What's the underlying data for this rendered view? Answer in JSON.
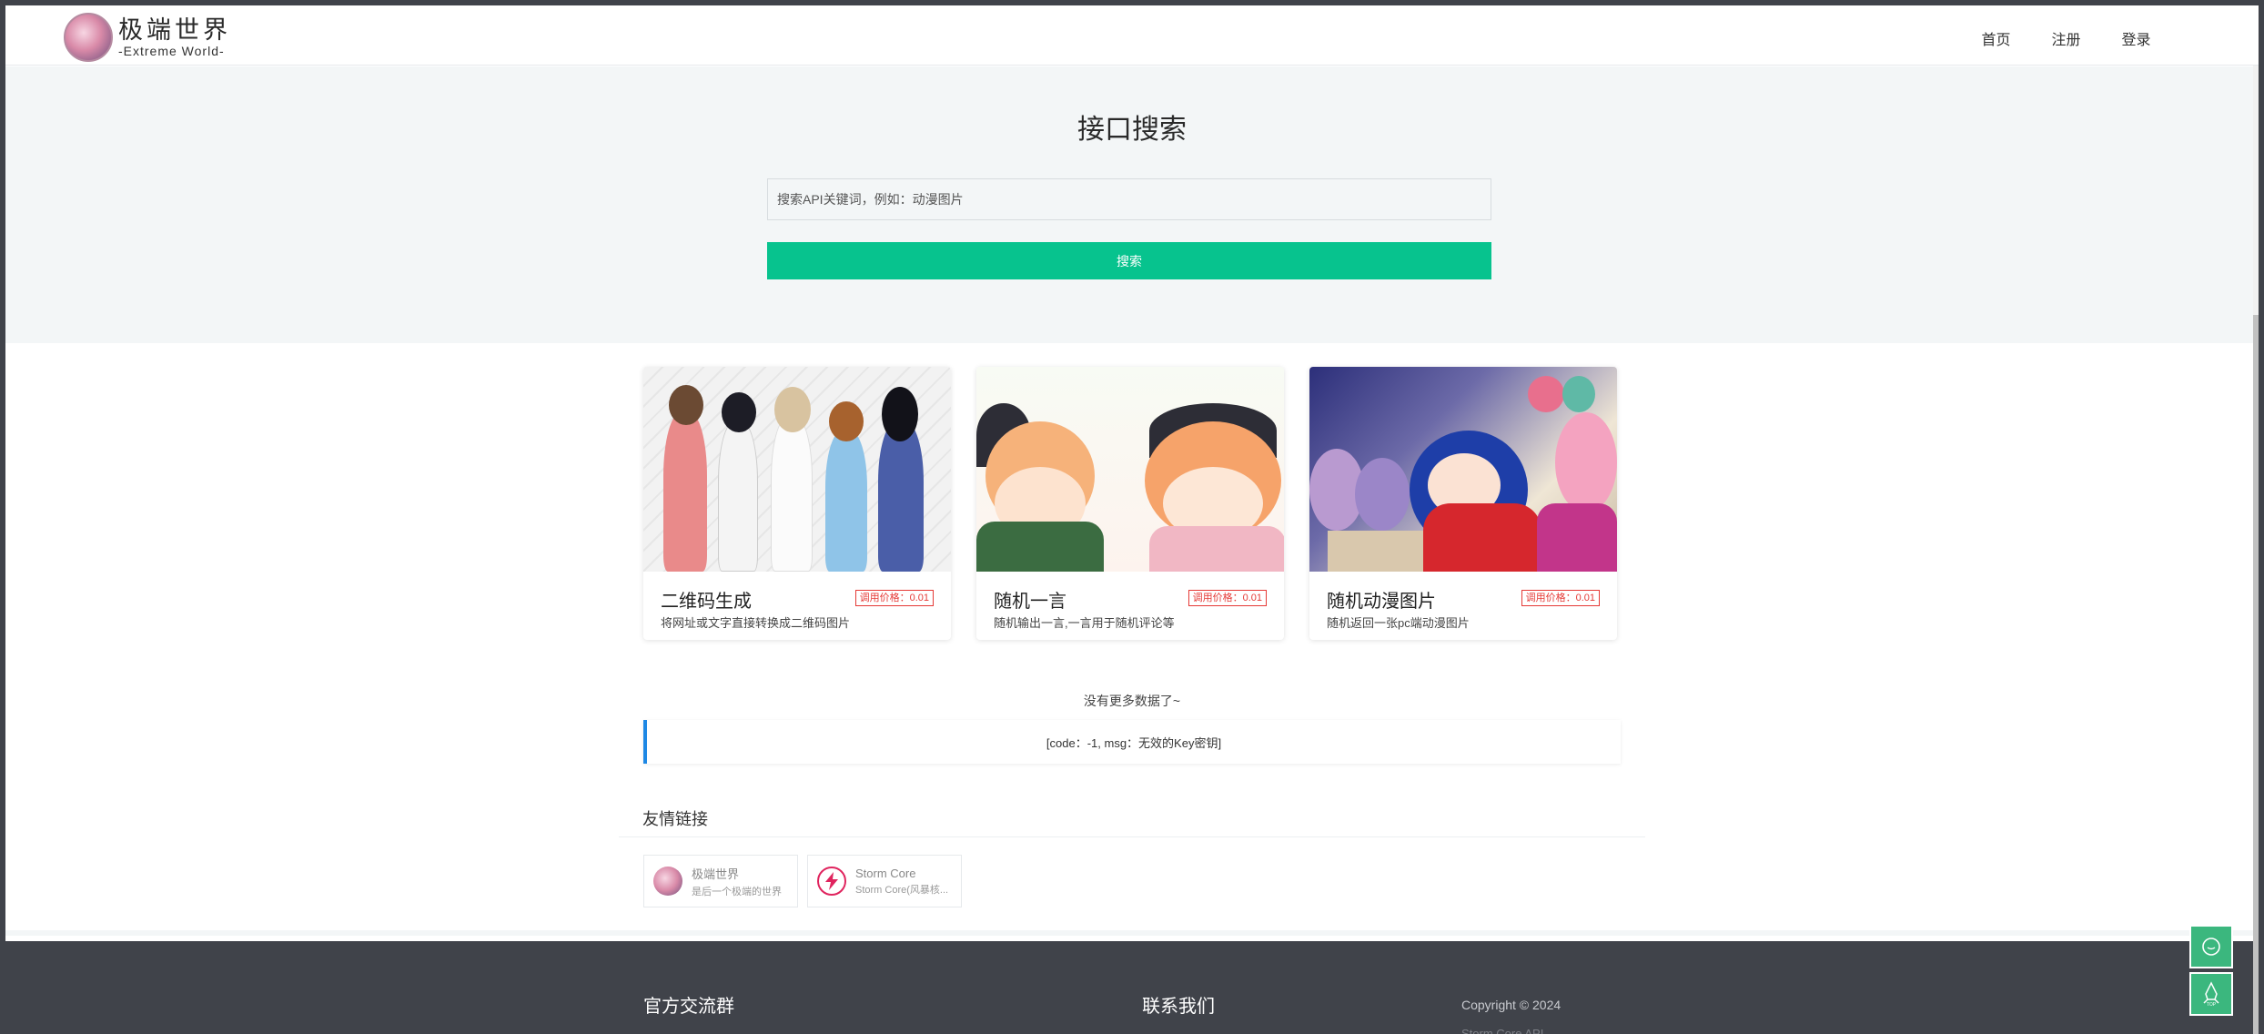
{
  "header": {
    "logo_title": "极端世界",
    "logo_subtitle": "-Extreme World-",
    "nav": [
      {
        "label": "首页"
      },
      {
        "label": "注册"
      },
      {
        "label": "登录"
      }
    ]
  },
  "hero": {
    "title": "接口搜索",
    "search_placeholder": "搜索API关键词，例如：动漫图片",
    "search_button": "搜索"
  },
  "cards": [
    {
      "name": "二维码生成",
      "price": "调用价格：0.01",
      "desc": "将网址或文字直接转换成二维码图片"
    },
    {
      "name": "随机一言",
      "price": "调用价格：0.01",
      "desc": "随机输出一言,一言用于随机评论等"
    },
    {
      "name": "随机动漫图片",
      "price": "调用价格：0.01",
      "desc": "随机返回一张pc端动漫图片"
    }
  ],
  "no_more": "没有更多数据了~",
  "message": "[code：-1, msg：无效的Key密钥]",
  "links": {
    "title": "友情链接",
    "items": [
      {
        "name": "极端世界",
        "desc": "是后一个极端的世界"
      },
      {
        "name": "Storm Core",
        "desc": "Storm Core(风暴核..."
      }
    ]
  },
  "footer": {
    "col1_title": "官方交流群",
    "col2_title": "联系我们",
    "copyright": "Copyright © 2024",
    "faded_line": "Storm Core API"
  },
  "colors": {
    "accent_green": "#07c38e",
    "price_red": "#e53935",
    "message_blue": "#1e88e5",
    "footer_bg": "#40434a"
  },
  "icons": [
    "chat-icon",
    "rocket-top-icon"
  ]
}
